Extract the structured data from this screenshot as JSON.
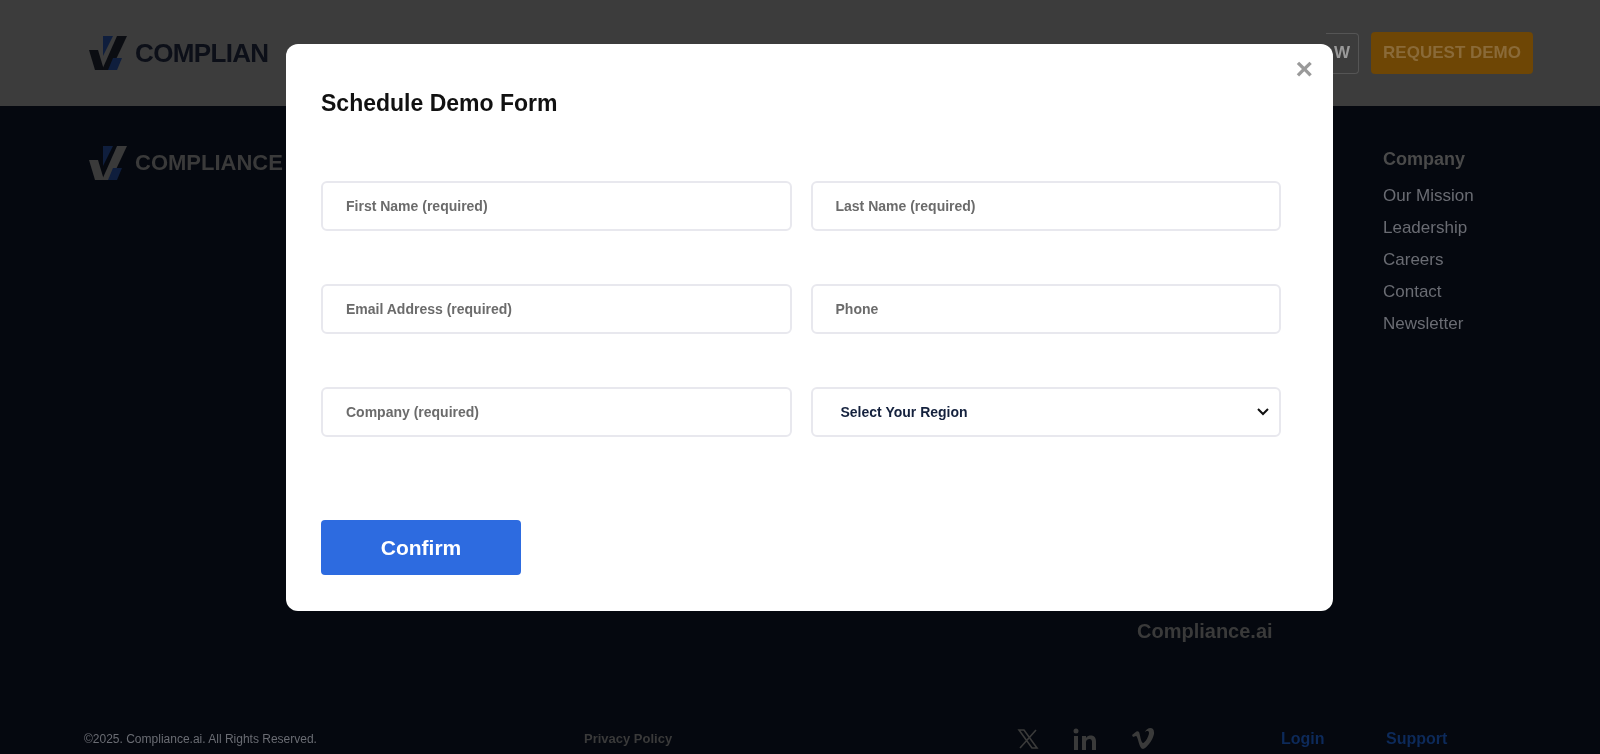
{
  "header": {
    "logo_text": "COMPLIAN",
    "buttons": [
      {
        "label": "W",
        "kind": "outline"
      },
      {
        "label": "REQUEST DEMO",
        "kind": "filled"
      }
    ]
  },
  "footer": {
    "logo_text": "COMPLIANCE",
    "partial_text": "Compliance.ai",
    "columns": [
      {
        "title": "Company",
        "links": [
          "Our Mission",
          "Leadership",
          "Careers",
          "Contact",
          "Newsletter"
        ]
      }
    ],
    "copyright": "©2025. Compliance.ai. All Rights Reserved.",
    "privacy": "Privacy Policy",
    "bottom_links": [
      "Login",
      "Support"
    ]
  },
  "modal": {
    "title": "Schedule Demo Form",
    "close": "×",
    "fields": [
      {
        "kind": "input",
        "placeholder": "First Name (required)"
      },
      {
        "kind": "input",
        "placeholder": "Last Name (required)"
      },
      {
        "kind": "input",
        "placeholder": "Email Address (required)"
      },
      {
        "kind": "input",
        "placeholder": "Phone"
      },
      {
        "kind": "input",
        "placeholder": "Company (required)"
      },
      {
        "kind": "select",
        "value": "Select Your Region"
      }
    ],
    "submit": "Confirm"
  }
}
